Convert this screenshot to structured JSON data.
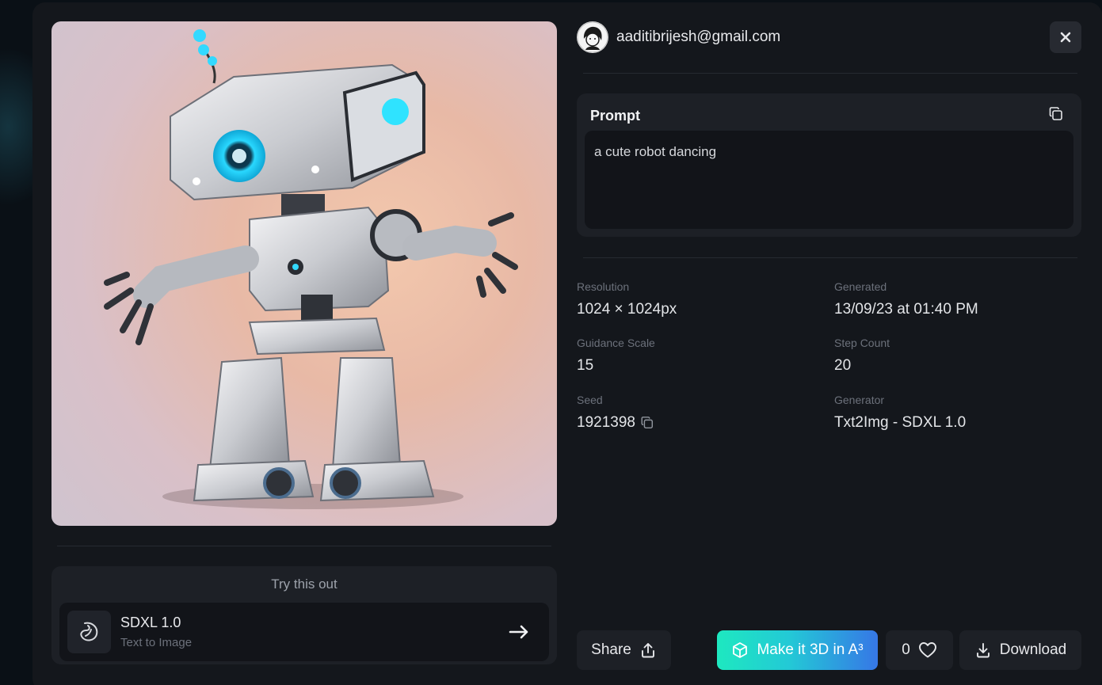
{
  "user": {
    "email": "aaditibrijesh@gmail.com",
    "avatar_icon": "cartoon-avatar-icon"
  },
  "close": {
    "icon": "close-icon"
  },
  "image": {
    "alt": "a cute robot dancing"
  },
  "prompt": {
    "title": "Prompt",
    "text": "a cute robot dancing",
    "copy_icon": "copy-icon"
  },
  "details": {
    "resolution": {
      "label": "Resolution",
      "value": "1024 × 1024px"
    },
    "generated": {
      "label": "Generated",
      "value": "13/09/23 at 01:40 PM"
    },
    "guidance": {
      "label": "Guidance Scale",
      "value": "15"
    },
    "steps": {
      "label": "Step Count",
      "value": "20"
    },
    "seed": {
      "label": "Seed",
      "value": "1921398"
    },
    "generator": {
      "label": "Generator",
      "value": "Txt2Img - SDXL 1.0"
    }
  },
  "try_card": {
    "title": "Try this out",
    "model_name": "SDXL 1.0",
    "model_subtitle": "Text to Image",
    "model_icon": "bean-icon",
    "arrow_icon": "arrow-right-icon"
  },
  "actions": {
    "share_label": "Share",
    "make3d_label": "Make it 3D in A³",
    "like_count": "0",
    "download_label": "Download"
  },
  "colors": {
    "background": "#0a1016",
    "panel": "#14171c",
    "card": "#1d2026",
    "accent_start": "#1ee8c0",
    "accent_end": "#3677e6"
  }
}
